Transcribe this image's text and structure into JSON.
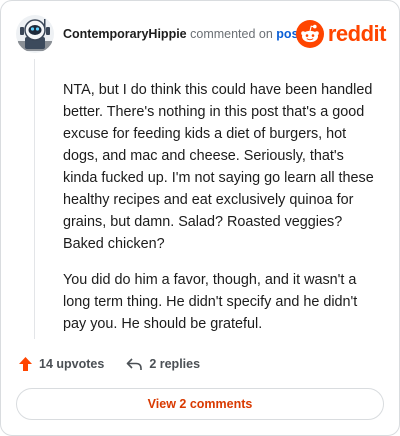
{
  "comment": {
    "username": "ContemporaryHippie",
    "action_text": "commented on",
    "post_link_label": "post",
    "paragraphs": [
      "NTA, but I do think this could have been handled better. There's nothing in this post that's a good excuse for feeding kids a diet of burgers, hot dogs, and mac and cheese. Seriously, that's kinda fucked up. I'm not saying go learn all these healthy recipes and eat exclusively quinoa for grains, but damn. Salad? Roasted veggies? Baked chicken?",
      "You did do him a favor, though, and it wasn't a long term thing. He didn't specify and he didn't pay you. He should be grateful."
    ]
  },
  "brand": {
    "logo_text": "reddit",
    "color": "#ff4500",
    "icon": "reddit-snoo-icon"
  },
  "actions": {
    "upvotes_label": "14 upvotes",
    "replies_label": "2 replies",
    "upvote_icon": "upvote-arrow-icon",
    "reply_icon": "reply-arrow-icon",
    "upvote_color": "#ff4500"
  },
  "footer": {
    "view_comments_label": "View 2 comments",
    "accent": "#d93900"
  },
  "colors": {
    "link": "#0a5fd7",
    "muted": "#6b7075",
    "border": "#d9dcdf"
  }
}
